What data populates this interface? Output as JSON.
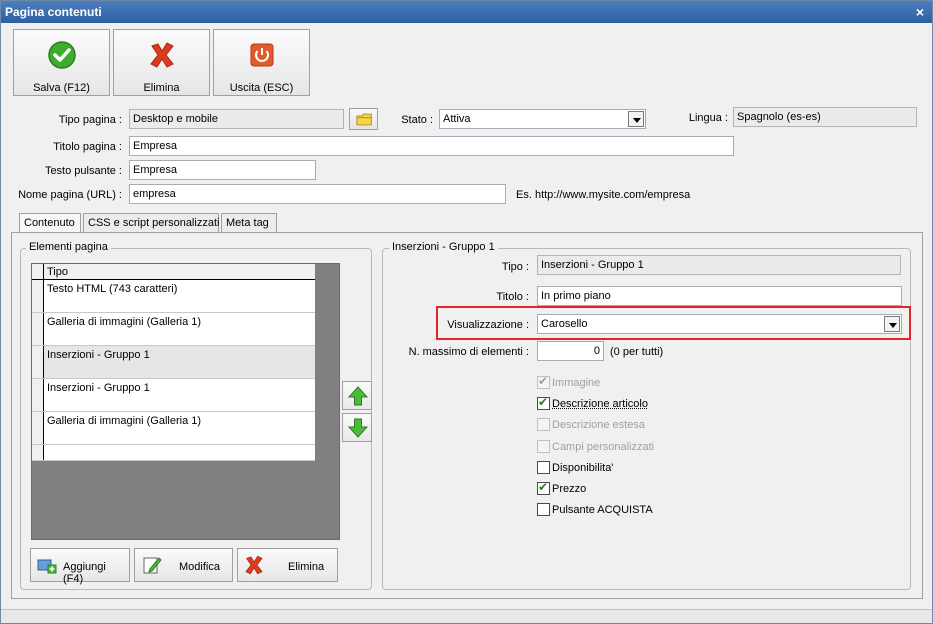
{
  "window": {
    "title": "Pagina contenuti",
    "close_glyph": "×"
  },
  "toolbar": {
    "save_label": "Salva (F12)",
    "delete_label": "Elimina",
    "exit_label": "Uscita (ESC)",
    "colors": {
      "save": "#3cae2c",
      "delete": "#e03a1e",
      "exit": "#e25a2a"
    }
  },
  "form": {
    "tipo_pagina": {
      "label": "Tipo pagina :",
      "value": "Desktop e mobile"
    },
    "stato": {
      "label": "Stato :",
      "value": "Attiva"
    },
    "lingua": {
      "label": "Lingua :",
      "value": "Spagnolo (es-es)"
    },
    "titolo_pagina": {
      "label": "Titolo pagina :",
      "value": "Empresa"
    },
    "testo_pulsante": {
      "label": "Testo pulsante :",
      "value": "Empresa"
    },
    "nome_pagina": {
      "label": "Nome pagina (URL) :",
      "value": "empresa",
      "hint": "Es. http://www.mysite.com/empresa"
    }
  },
  "tabs": [
    {
      "label": "Contenuto",
      "active": true
    },
    {
      "label": "CSS e script personalizzati",
      "active": false
    },
    {
      "label": "Meta tag",
      "active": false
    }
  ],
  "elements_panel": {
    "title": "Elementi pagina",
    "column_header": "Tipo",
    "rows": [
      {
        "tipo": "Testo HTML (743 caratteri)",
        "selected": false
      },
      {
        "tipo": "Galleria di immagini (Galleria 1)",
        "selected": false
      },
      {
        "tipo": "Inserzioni - Gruppo 1",
        "selected": true
      },
      {
        "tipo": "Inserzioni - Gruppo 1",
        "selected": false
      },
      {
        "tipo": "Galleria di immagini (Galleria 1)",
        "selected": false
      }
    ],
    "add_label": "Aggiungi (F4)",
    "edit_label": "Modifica",
    "delete_label": "Elimina"
  },
  "insertions_panel": {
    "title": "Inserzioni - Gruppo 1",
    "tipo": {
      "label": "Tipo :",
      "value": "Inserzioni - Gruppo 1"
    },
    "titolo": {
      "label": "Titolo :",
      "value": "In primo piano"
    },
    "visualizzazione": {
      "label": "Visualizzazione :",
      "value": "Carosello"
    },
    "max_elementi": {
      "label": "N. massimo di elementi :",
      "value": "0",
      "hint": "(0 per tutti)"
    },
    "checkboxes": [
      {
        "label": "Immagine",
        "checked": true,
        "disabled": true
      },
      {
        "label": "Descrizione articolo",
        "checked": true,
        "disabled": false
      },
      {
        "label": "Descrizione estesa",
        "checked": false,
        "disabled": true
      },
      {
        "label": "Campi personalizzati",
        "checked": false,
        "disabled": true
      },
      {
        "label": "Disponibilita'",
        "checked": false,
        "disabled": false
      },
      {
        "label": "Prezzo",
        "checked": true,
        "disabled": false
      },
      {
        "label": "Pulsante ACQUISTA",
        "checked": false,
        "disabled": false
      }
    ]
  },
  "highlight_color": "#e0262b"
}
